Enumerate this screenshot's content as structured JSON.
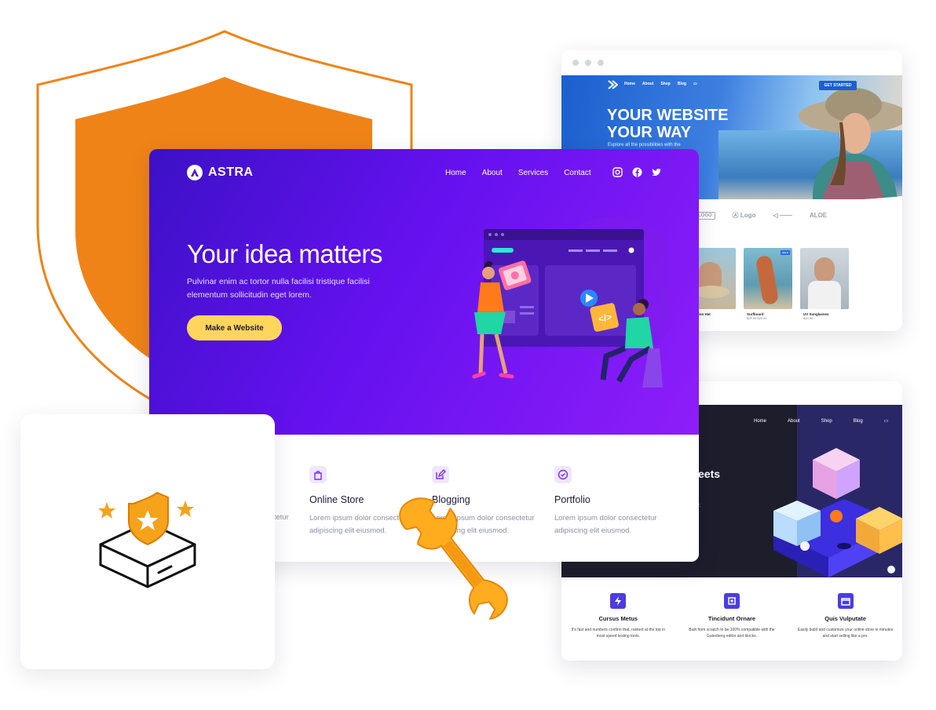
{
  "main_site": {
    "brand": "ASTRA",
    "nav": [
      "Home",
      "About",
      "Services",
      "Contact"
    ],
    "social_icons": [
      "instagram-icon",
      "facebook-icon",
      "twitter-icon"
    ],
    "hero_title": "Your idea matters",
    "hero_text": "Pulvinar enim ac tortor nulla facilisi tristique facilisi elementum sollicitudin eget lorem.",
    "cta": "Make a Website",
    "services": [
      {
        "icon": "bag-icon",
        "title": "Online Store",
        "text": "Lorem ipsum dolor consectetur adipiscing elit eiusmod."
      },
      {
        "icon": "edit-icon",
        "title": "Blogging",
        "text": "Lorem ipsum dolor consectetur adipiscing elit eiusmod."
      },
      {
        "icon": "badge-check-icon",
        "title": "Portfolio",
        "text": "Lorem ipsum dolor consectetur adipiscing elit eiusmod."
      }
    ],
    "partial_left_text": "ctetur",
    "colors": {
      "hero_start": "#3c11c6",
      "hero_end": "#8e1ef9",
      "cta": "#ffd65c",
      "accent": "#f0830f"
    }
  },
  "top_right_site": {
    "nav": [
      "Home",
      "About",
      "Shop",
      "Blog"
    ],
    "cta": "GET STARTED",
    "hero_title_line1": "YOUR WEBSITE",
    "hero_title_line2": "YOUR WAY",
    "hero_sub": "Explore all the possibilities with the",
    "logos": [
      "LOGO",
      "Logo",
      "",
      "ALOE"
    ],
    "products": [
      {
        "name": "Fashion Hat",
        "price": "",
        "sale": ""
      },
      {
        "name": "Surfboard",
        "price": "$29.00 $20.00",
        "sale": "SALE"
      },
      {
        "name": "UV Sunglasses",
        "price": "$14.00",
        "sale": ""
      }
    ]
  },
  "bottom_right_site": {
    "nav": [
      "Home",
      "About",
      "Shop",
      "Blog"
    ],
    "hero_partial_title": "eets",
    "hero_partial_text": "r.",
    "features": [
      {
        "title": "Cursus Metus",
        "text": "It's fast and numbers confirm that, ranked at the top in most speed testing tools."
      },
      {
        "title": "Tincidunt Ornare",
        "text": "Built from scratch to be 100% compatible with the Gutenberg editor and blocks."
      },
      {
        "title": "Quis Vulputate",
        "text": "Easily build and customize your online store in minutes and start selling like a pro."
      }
    ]
  }
}
